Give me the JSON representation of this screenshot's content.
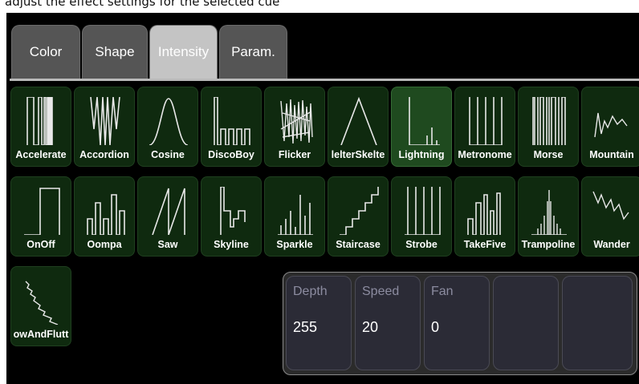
{
  "top_text": "adjust the effect settings for the selected cue",
  "tabs": [
    {
      "label": "Color",
      "active": false
    },
    {
      "label": "Shape",
      "active": false
    },
    {
      "label": "Intensity",
      "active": true
    },
    {
      "label": "Param.",
      "active": false
    }
  ],
  "effects": [
    {
      "label": "Accelerate",
      "icon": "accelerate-waveform-icon"
    },
    {
      "label": "Accordion",
      "icon": "accordion-waveform-icon"
    },
    {
      "label": "Cosine",
      "icon": "cosine-waveform-icon"
    },
    {
      "label": "DiscoBoy",
      "icon": "discoboy-waveform-icon"
    },
    {
      "label": "Flicker",
      "icon": "flicker-waveform-icon"
    },
    {
      "label": "lelterSkelte",
      "icon": "helterskelter-waveform-icon"
    },
    {
      "label": "Lightning",
      "icon": "lightning-waveform-icon",
      "selected": true
    },
    {
      "label": "Metronome",
      "icon": "metronome-waveform-icon"
    },
    {
      "label": "Morse",
      "icon": "morse-waveform-icon"
    },
    {
      "label": "Mountain",
      "icon": "mountain-waveform-icon"
    },
    {
      "label": "OnOff",
      "icon": "onoff-waveform-icon"
    },
    {
      "label": "Oompa",
      "icon": "oompa-waveform-icon"
    },
    {
      "label": "Saw",
      "icon": "saw-waveform-icon"
    },
    {
      "label": "Skyline",
      "icon": "skyline-waveform-icon"
    },
    {
      "label": "Sparkle",
      "icon": "sparkle-waveform-icon"
    },
    {
      "label": "Staircase",
      "icon": "staircase-waveform-icon"
    },
    {
      "label": "Strobe",
      "icon": "strobe-waveform-icon"
    },
    {
      "label": "TakeFive",
      "icon": "takefive-waveform-icon"
    },
    {
      "label": "Trampoline",
      "icon": "trampoline-waveform-icon"
    },
    {
      "label": "Wander",
      "icon": "wander-waveform-icon"
    },
    {
      "label": "owAndFlutt",
      "icon": "wowandflutter-waveform-icon"
    }
  ],
  "params": [
    {
      "label": "Depth",
      "value": "255"
    },
    {
      "label": "Speed",
      "value": "20"
    },
    {
      "label": "Fan",
      "value": "0"
    },
    {
      "label": "",
      "value": ""
    },
    {
      "label": "",
      "value": ""
    }
  ],
  "colors": {
    "panel_bg": "#000000",
    "tile_bg": "#0f2a0f",
    "tile_selected_bg": "#1f4a1f",
    "tab_bg": "#555555",
    "tab_active_bg": "#c4c4c4",
    "param_bg": "#2b2b36",
    "param_label": "#8c8ca0"
  }
}
